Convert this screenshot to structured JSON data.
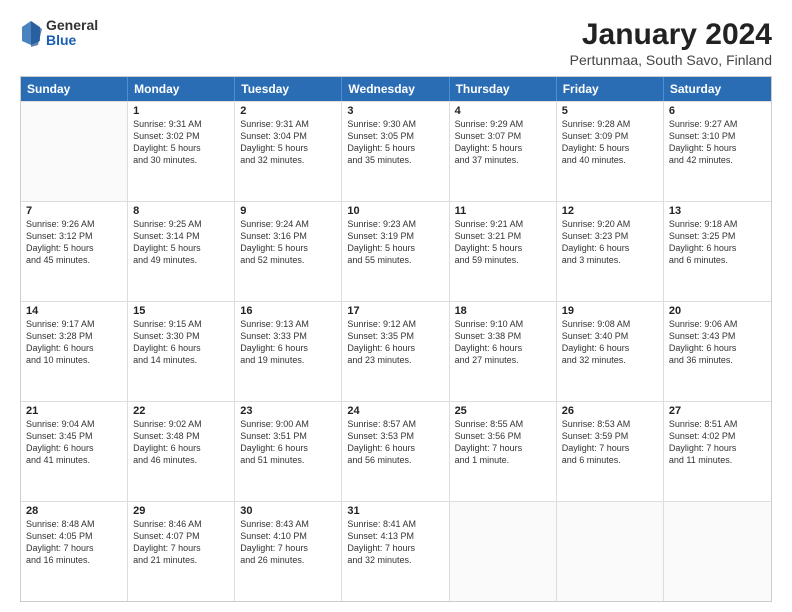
{
  "header": {
    "logo": {
      "general": "General",
      "blue": "Blue"
    },
    "title": "January 2024",
    "location": "Pertunmaa, South Savo, Finland"
  },
  "days_of_week": [
    "Sunday",
    "Monday",
    "Tuesday",
    "Wednesday",
    "Thursday",
    "Friday",
    "Saturday"
  ],
  "weeks": [
    [
      {
        "day": "",
        "info": ""
      },
      {
        "day": "1",
        "info": "Sunrise: 9:31 AM\nSunset: 3:02 PM\nDaylight: 5 hours\nand 30 minutes."
      },
      {
        "day": "2",
        "info": "Sunrise: 9:31 AM\nSunset: 3:04 PM\nDaylight: 5 hours\nand 32 minutes."
      },
      {
        "day": "3",
        "info": "Sunrise: 9:30 AM\nSunset: 3:05 PM\nDaylight: 5 hours\nand 35 minutes."
      },
      {
        "day": "4",
        "info": "Sunrise: 9:29 AM\nSunset: 3:07 PM\nDaylight: 5 hours\nand 37 minutes."
      },
      {
        "day": "5",
        "info": "Sunrise: 9:28 AM\nSunset: 3:09 PM\nDaylight: 5 hours\nand 40 minutes."
      },
      {
        "day": "6",
        "info": "Sunrise: 9:27 AM\nSunset: 3:10 PM\nDaylight: 5 hours\nand 42 minutes."
      }
    ],
    [
      {
        "day": "7",
        "info": "Sunrise: 9:26 AM\nSunset: 3:12 PM\nDaylight: 5 hours\nand 45 minutes."
      },
      {
        "day": "8",
        "info": "Sunrise: 9:25 AM\nSunset: 3:14 PM\nDaylight: 5 hours\nand 49 minutes."
      },
      {
        "day": "9",
        "info": "Sunrise: 9:24 AM\nSunset: 3:16 PM\nDaylight: 5 hours\nand 52 minutes."
      },
      {
        "day": "10",
        "info": "Sunrise: 9:23 AM\nSunset: 3:19 PM\nDaylight: 5 hours\nand 55 minutes."
      },
      {
        "day": "11",
        "info": "Sunrise: 9:21 AM\nSunset: 3:21 PM\nDaylight: 5 hours\nand 59 minutes."
      },
      {
        "day": "12",
        "info": "Sunrise: 9:20 AM\nSunset: 3:23 PM\nDaylight: 6 hours\nand 3 minutes."
      },
      {
        "day": "13",
        "info": "Sunrise: 9:18 AM\nSunset: 3:25 PM\nDaylight: 6 hours\nand 6 minutes."
      }
    ],
    [
      {
        "day": "14",
        "info": "Sunrise: 9:17 AM\nSunset: 3:28 PM\nDaylight: 6 hours\nand 10 minutes."
      },
      {
        "day": "15",
        "info": "Sunrise: 9:15 AM\nSunset: 3:30 PM\nDaylight: 6 hours\nand 14 minutes."
      },
      {
        "day": "16",
        "info": "Sunrise: 9:13 AM\nSunset: 3:33 PM\nDaylight: 6 hours\nand 19 minutes."
      },
      {
        "day": "17",
        "info": "Sunrise: 9:12 AM\nSunset: 3:35 PM\nDaylight: 6 hours\nand 23 minutes."
      },
      {
        "day": "18",
        "info": "Sunrise: 9:10 AM\nSunset: 3:38 PM\nDaylight: 6 hours\nand 27 minutes."
      },
      {
        "day": "19",
        "info": "Sunrise: 9:08 AM\nSunset: 3:40 PM\nDaylight: 6 hours\nand 32 minutes."
      },
      {
        "day": "20",
        "info": "Sunrise: 9:06 AM\nSunset: 3:43 PM\nDaylight: 6 hours\nand 36 minutes."
      }
    ],
    [
      {
        "day": "21",
        "info": "Sunrise: 9:04 AM\nSunset: 3:45 PM\nDaylight: 6 hours\nand 41 minutes."
      },
      {
        "day": "22",
        "info": "Sunrise: 9:02 AM\nSunset: 3:48 PM\nDaylight: 6 hours\nand 46 minutes."
      },
      {
        "day": "23",
        "info": "Sunrise: 9:00 AM\nSunset: 3:51 PM\nDaylight: 6 hours\nand 51 minutes."
      },
      {
        "day": "24",
        "info": "Sunrise: 8:57 AM\nSunset: 3:53 PM\nDaylight: 6 hours\nand 56 minutes."
      },
      {
        "day": "25",
        "info": "Sunrise: 8:55 AM\nSunset: 3:56 PM\nDaylight: 7 hours\nand 1 minute."
      },
      {
        "day": "26",
        "info": "Sunrise: 8:53 AM\nSunset: 3:59 PM\nDaylight: 7 hours\nand 6 minutes."
      },
      {
        "day": "27",
        "info": "Sunrise: 8:51 AM\nSunset: 4:02 PM\nDaylight: 7 hours\nand 11 minutes."
      }
    ],
    [
      {
        "day": "28",
        "info": "Sunrise: 8:48 AM\nSunset: 4:05 PM\nDaylight: 7 hours\nand 16 minutes."
      },
      {
        "day": "29",
        "info": "Sunrise: 8:46 AM\nSunset: 4:07 PM\nDaylight: 7 hours\nand 21 minutes."
      },
      {
        "day": "30",
        "info": "Sunrise: 8:43 AM\nSunset: 4:10 PM\nDaylight: 7 hours\nand 26 minutes."
      },
      {
        "day": "31",
        "info": "Sunrise: 8:41 AM\nSunset: 4:13 PM\nDaylight: 7 hours\nand 32 minutes."
      },
      {
        "day": "",
        "info": ""
      },
      {
        "day": "",
        "info": ""
      },
      {
        "day": "",
        "info": ""
      }
    ]
  ]
}
